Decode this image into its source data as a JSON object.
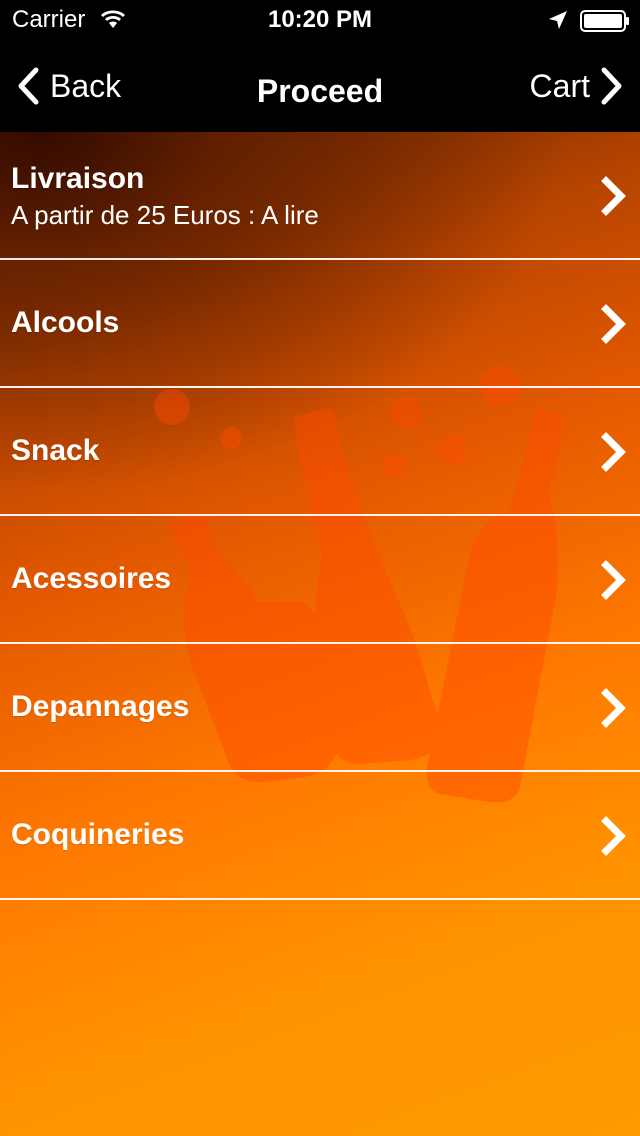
{
  "status_bar": {
    "carrier": "Carrier",
    "time": "10:20 PM",
    "icons": [
      "wifi-icon",
      "location-arrow-icon",
      "battery-icon"
    ]
  },
  "nav": {
    "back_label": "Back",
    "title": "Proceed",
    "cart_label": "Cart"
  },
  "menu": {
    "items": [
      {
        "title": "Livraison",
        "subtitle": "A partir de 25 Euros : A lire"
      },
      {
        "title": "Alcools",
        "subtitle": ""
      },
      {
        "title": "Snack",
        "subtitle": ""
      },
      {
        "title": "Acessoires",
        "subtitle": ""
      },
      {
        "title": "Depannages",
        "subtitle": ""
      },
      {
        "title": "Coquineries",
        "subtitle": ""
      }
    ]
  },
  "colors": {
    "bar_background": "#000000",
    "gradient_dark": "#5a1f00",
    "gradient_light": "#ff9c00",
    "text": "#ffffff"
  }
}
